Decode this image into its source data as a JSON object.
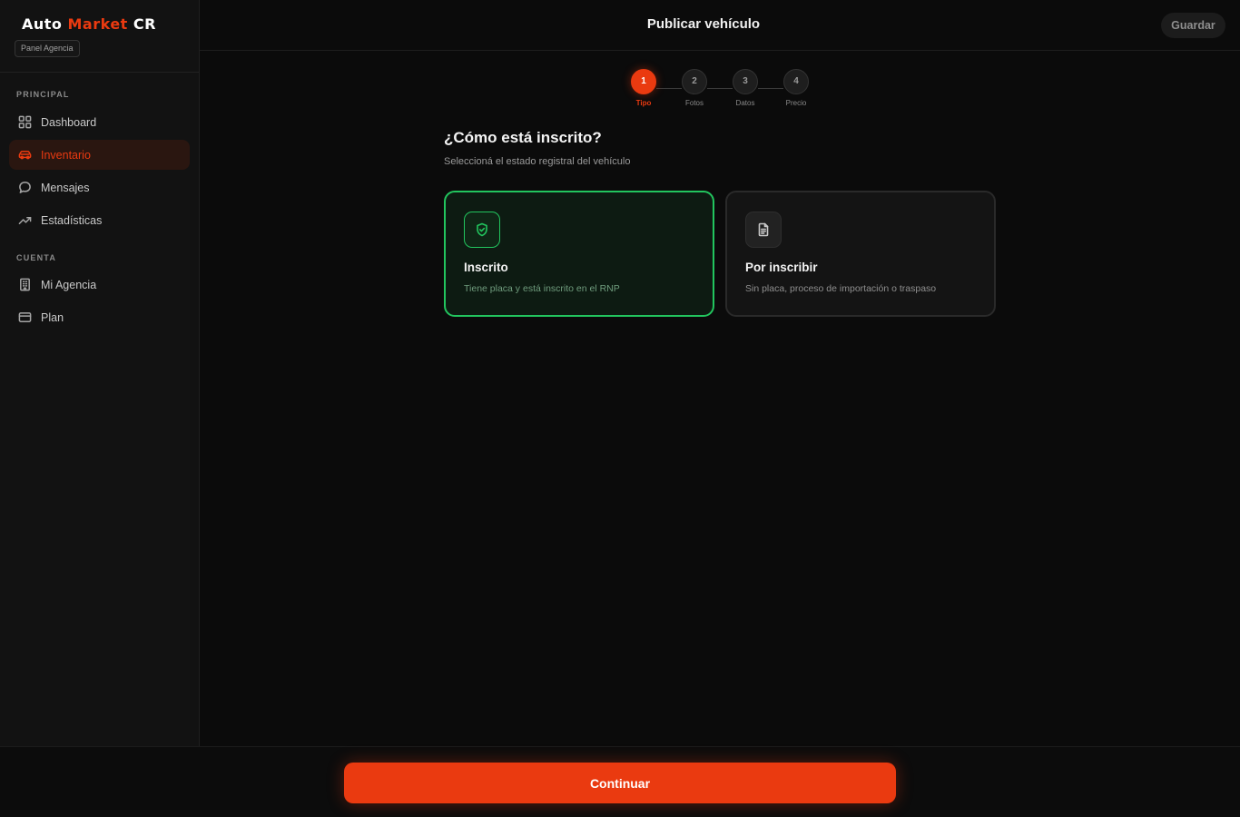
{
  "brand": {
    "part1": "Auto",
    "part2": "Market",
    "part3": "CR"
  },
  "sidebar": {
    "badge": "Panel Agencia",
    "sections": [
      {
        "label": "PRINCIPAL"
      },
      {
        "label": "CUENTA"
      }
    ],
    "items": [
      {
        "label": "Dashboard",
        "icon": "grid-icon"
      },
      {
        "label": "Inventario",
        "icon": "car-icon",
        "active": true
      },
      {
        "label": "Mensajes",
        "icon": "chat-icon"
      },
      {
        "label": "Estadísticas",
        "icon": "trending-up-icon"
      },
      {
        "label": "Mi Agencia",
        "icon": "building-icon"
      },
      {
        "label": "Plan",
        "icon": "credit-card-icon"
      }
    ]
  },
  "header": {
    "title": "Publicar vehículo",
    "save_label": "Guardar"
  },
  "stepper": {
    "steps": [
      {
        "number": "1",
        "label": "Tipo",
        "active": true
      },
      {
        "number": "2",
        "label": "Fotos"
      },
      {
        "number": "3",
        "label": "Datos"
      },
      {
        "number": "4",
        "label": "Precio"
      }
    ]
  },
  "main": {
    "question": "¿Cómo está inscrito?",
    "subtitle": "Seleccioná el estado registral del vehículo",
    "options": [
      {
        "title": "Inscrito",
        "description": "Tiene placa y está inscrito en el RNP",
        "icon": "shield-check-icon",
        "selected": true
      },
      {
        "title": "Por inscribir",
        "description": "Sin placa, proceso de importación o traspaso",
        "icon": "document-icon",
        "selected": false
      }
    ]
  },
  "footer": {
    "continue_label": "Continuar"
  },
  "colors": {
    "accent": "#ea3a10",
    "success": "#22c55e",
    "background": "#0b0b0b",
    "sidebar": "#121212"
  }
}
